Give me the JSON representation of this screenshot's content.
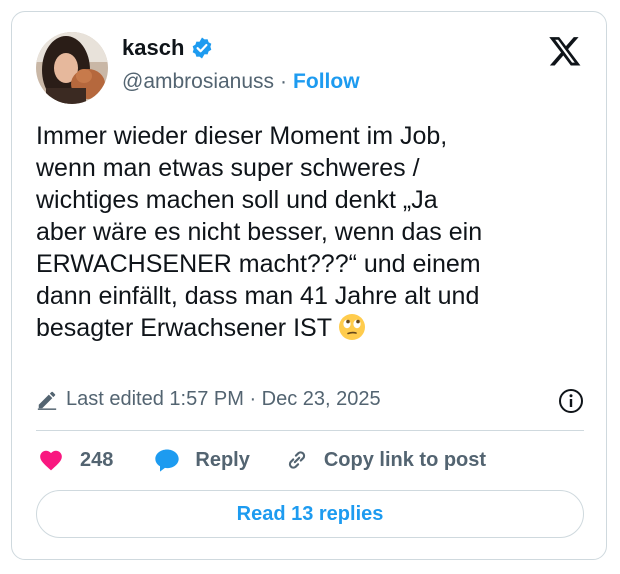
{
  "author": {
    "name": "kasch",
    "handle": "@ambrosianuss",
    "separator": "·",
    "follow_label": "Follow"
  },
  "icons": {
    "logo": "x-logo-icon",
    "verified": "verified-badge-icon",
    "edited": "pencil-icon",
    "info": "info-icon",
    "like": "heart-icon",
    "reply": "reply-bubble-icon",
    "copy": "link-icon",
    "emoji": "face-with-rolling-eyes-emoji"
  },
  "tweet": {
    "text": "Immer wieder dieser Moment im Job,\nwenn man etwas super schweres /\nwichtiges machen soll und denkt „Ja\naber wäre es nicht besser, wenn das ein\nERWACHSENER macht???“ und einem\ndann einfällt, dass man 41 Jahre alt und\nbesagter Erwachsener IST ",
    "edited_label": "Last edited 1:57 PM · Dec 23, 2025"
  },
  "actions": {
    "like_count": "248",
    "reply_label": "Reply",
    "copy_label": "Copy link to post"
  },
  "read_replies_label": "Read 13 replies",
  "colors": {
    "accent": "#1d9bf0",
    "like": "#f91880",
    "muted": "#536471",
    "text": "#0f1419",
    "border": "#cfd9de"
  }
}
